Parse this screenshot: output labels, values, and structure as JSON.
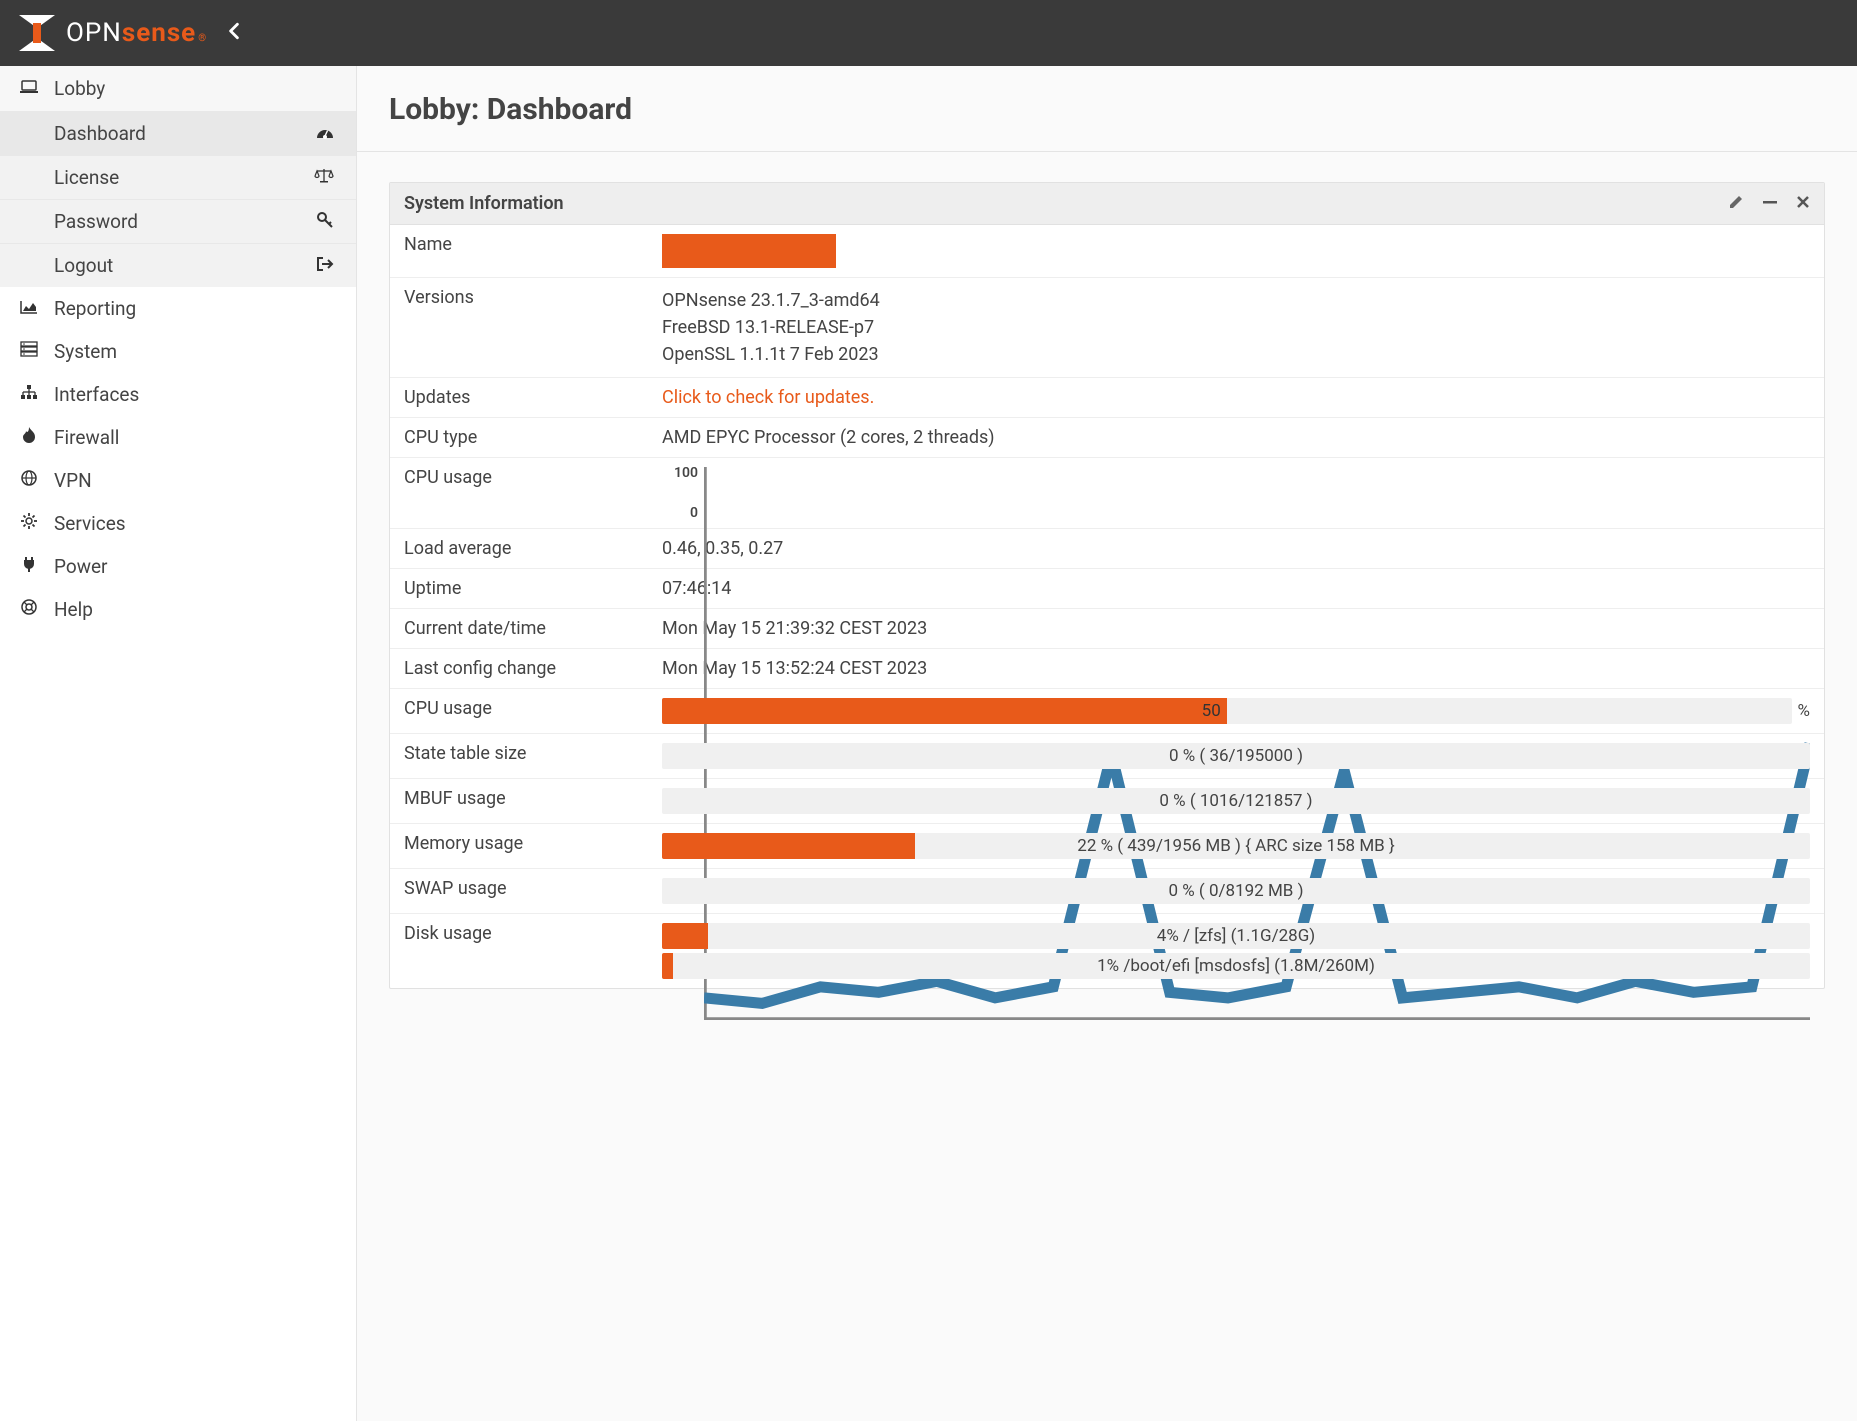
{
  "brand": {
    "opn": "OPN",
    "sense": "sense",
    "reg": "®"
  },
  "page": {
    "title": "Lobby: Dashboard"
  },
  "sidebar": {
    "lobby": {
      "label": "Lobby",
      "items": [
        {
          "label": "Dashboard"
        },
        {
          "label": "License"
        },
        {
          "label": "Password"
        },
        {
          "label": "Logout"
        }
      ]
    },
    "groups": [
      {
        "label": "Reporting"
      },
      {
        "label": "System"
      },
      {
        "label": "Interfaces"
      },
      {
        "label": "Firewall"
      },
      {
        "label": "VPN"
      },
      {
        "label": "Services"
      },
      {
        "label": "Power"
      },
      {
        "label": "Help"
      }
    ]
  },
  "widget": {
    "title": "System Information",
    "rows": {
      "name_label": "Name",
      "versions_label": "Versions",
      "versions": {
        "line1": "OPNsense 23.1.7_3-amd64",
        "line2": "FreeBSD 13.1-RELEASE-p7",
        "line3": "OpenSSL 1.1.1t 7 Feb 2023"
      },
      "updates_label": "Updates",
      "updates_value": "Click to check for updates.",
      "cpu_type_label": "CPU type",
      "cpu_type_value": "AMD EPYC Processor (2 cores, 2 threads)",
      "cpu_usage_label": "CPU usage",
      "load_label": "Load average",
      "load_value": "0.46, 0.35, 0.27",
      "uptime_label": "Uptime",
      "uptime_value": "07:46:14",
      "datetime_label": "Current date/time",
      "datetime_value": "Mon May 15 21:39:32 CEST 2023",
      "lastcfg_label": "Last config change",
      "lastcfg_value": "Mon May 15 13:52:24 CEST 2023",
      "cpu_usage2_label": "CPU usage",
      "cpu_usage2_pct": "50",
      "cpu_usage2_suffix": "%",
      "state_label": "State table size",
      "state_text": "0 % ( 36/195000 )",
      "mbuf_label": "MBUF usage",
      "mbuf_text": "0 % ( 1016/121857 )",
      "mem_label": "Memory usage",
      "mem_text": "22 % ( 439/1956 MB ) { ARC size 158 MB }",
      "swap_label": "SWAP usage",
      "swap_text": "0 % ( 0/8192 MB )",
      "disk_label": "Disk usage",
      "disk1_text": "4% / [zfs] (1.1G/28G)",
      "disk2_text": "1% /boot/efi [msdosfs] (1.8M/260M)"
    }
  },
  "chart_data": {
    "type": "line",
    "title": "CPU usage",
    "ylabel": "",
    "ylim": [
      0,
      100
    ],
    "ytick_top": "100",
    "ytick_bottom": "0",
    "series": [
      {
        "name": "cpu",
        "values": [
          4,
          3,
          6,
          5,
          7,
          4,
          6,
          48,
          5,
          4,
          6,
          45,
          4,
          5,
          6,
          4,
          7,
          5,
          6,
          50
        ]
      }
    ]
  },
  "bars": {
    "cpu_pct": 50,
    "state_pct": 0,
    "mbuf_pct": 0,
    "mem_pct": 22,
    "swap_pct": 0,
    "disk1_pct": 4,
    "disk2_pct": 1
  }
}
